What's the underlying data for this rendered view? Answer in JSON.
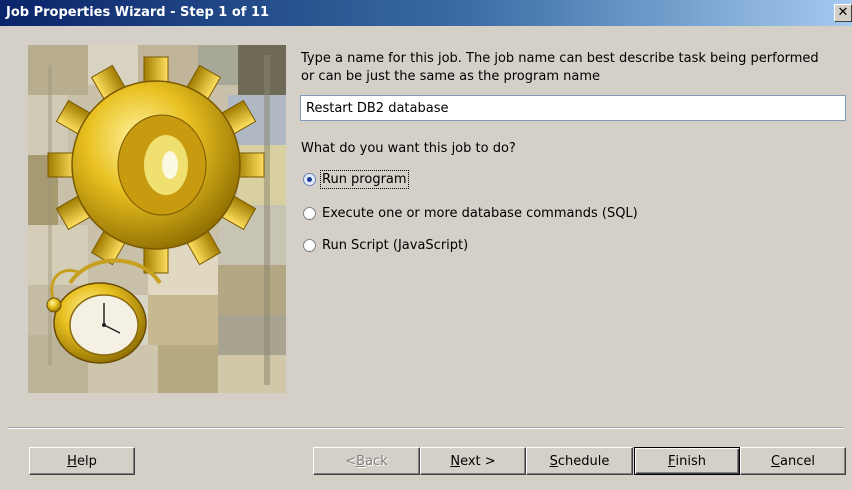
{
  "window": {
    "title": "Job Properties Wizard - Step 1 of 11",
    "close_label": "✕"
  },
  "form": {
    "prompt": "Type a name for this job. The job name can best describe task being performed or can be just the same as the program name",
    "job_name": "Restart DB2 database",
    "question": "What do you want this job to do?",
    "options": [
      {
        "label": "Run program",
        "checked": true
      },
      {
        "label": "Execute one or more database commands (SQL)",
        "checked": false
      },
      {
        "label": "Run Script (JavaScript)",
        "checked": false
      }
    ]
  },
  "buttons": {
    "help": {
      "pre": "",
      "u": "H",
      "post": "elp"
    },
    "back": {
      "pre": "< ",
      "u": "B",
      "post": "ack"
    },
    "next": {
      "pre": "",
      "u": "N",
      "post": "ext >"
    },
    "schedule": {
      "pre": "",
      "u": "S",
      "post": "chedule"
    },
    "finish": {
      "pre": "",
      "u": "F",
      "post": "inish"
    },
    "cancel": {
      "pre": "",
      "u": "C",
      "post": "ancel"
    }
  },
  "colors": {
    "title_bar_start": "#0a246a",
    "title_bar_end": "#a6caf0",
    "dialog_background": "#d4d0c8",
    "artwork_gold": "#e8c020"
  },
  "icons": {
    "wizard_artwork": "gear-and-pocket-watch-artwork"
  }
}
